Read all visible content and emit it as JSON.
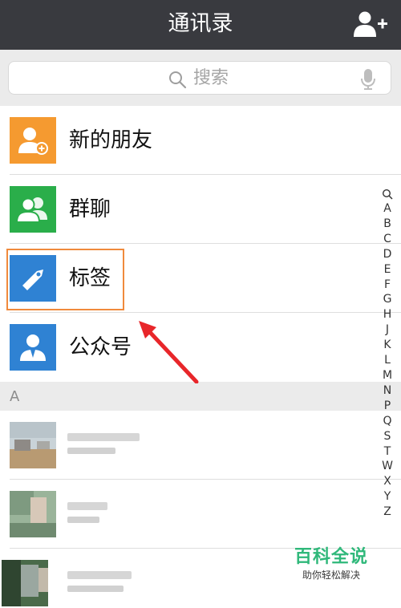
{
  "nav": {
    "title": "通讯录",
    "add_icon": "add-contact-icon"
  },
  "search": {
    "placeholder": "搜索",
    "icon": "search-icon",
    "voice_icon": "microphone-icon"
  },
  "menu": [
    {
      "label": "新的朋友",
      "icon": "new-friends-icon",
      "color": "#f59a30"
    },
    {
      "label": "群聊",
      "icon": "group-chat-icon",
      "color": "#2aae4a"
    },
    {
      "label": "标签",
      "icon": "tag-icon",
      "color": "#2f82d3"
    },
    {
      "label": "公众号",
      "icon": "official-account-icon",
      "color": "#2f82d3"
    }
  ],
  "section": {
    "letter": "A"
  },
  "index": [
    "A",
    "B",
    "C",
    "D",
    "E",
    "F",
    "G",
    "H",
    "J",
    "K",
    "L",
    "M",
    "N",
    "P",
    "Q",
    "S",
    "T",
    "W",
    "X",
    "Y",
    "Z"
  ],
  "watermark": {
    "title": "百科全说",
    "subtitle": "助你轻松解决"
  },
  "colors": {
    "nav_bg": "#393a3f",
    "highlight": "#f08a3c",
    "arrow": "#e8262a"
  }
}
